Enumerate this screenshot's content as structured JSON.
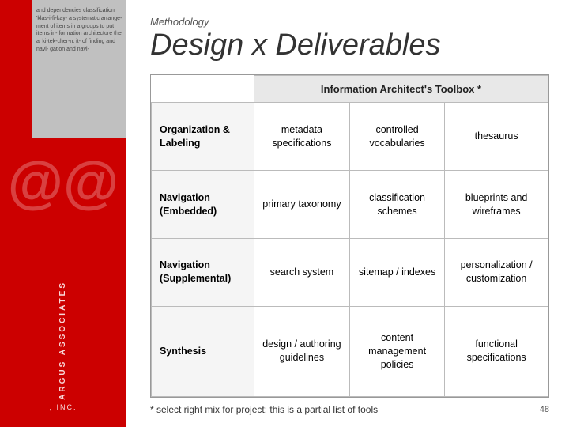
{
  "sidebar": {
    "at_symbol": "@@",
    "company_name": "ARGUS ASSOCIATES",
    "company_inc": ", INC.",
    "image_text": "and dependencies\nclassification 'klas-i-fi-kay-\na systematic arrange-\nment of items in a\ngroups to put items in-\nformation architecture\nthe al ki-tek-cher-n, it-\nof finding and navi-\ngation and navi-"
  },
  "header": {
    "methodology": "Methodology",
    "title": "Design x Deliverables"
  },
  "table": {
    "toolbox_header": "Information Architect's Toolbox *",
    "columns": [
      "",
      "Information Architect's Toolbox *",
      "",
      ""
    ],
    "col_headers": [
      "metadata specifications",
      "controlled vocabularies",
      "thesaurus"
    ],
    "rows": [
      {
        "label": "Organization & Labeling",
        "col1": "metadata specifications",
        "col2": "controlled vocabularies",
        "col3": "thesaurus"
      },
      {
        "label": "Navigation (Embedded)",
        "col1": "primary taxonomy",
        "col2": "classification schemes",
        "col3": "blueprints and wireframes"
      },
      {
        "label": "Navigation (Supplemental)",
        "col1": "search system",
        "col2": "sitemap / indexes",
        "col3": "personalization / customization"
      },
      {
        "label": "Synthesis",
        "col1": "design / authoring guidelines",
        "col2": "content management policies",
        "col3": "functional specifications"
      }
    ]
  },
  "footer": {
    "note": "* select right mix for project; this is a partial list of tools",
    "page": "48"
  }
}
